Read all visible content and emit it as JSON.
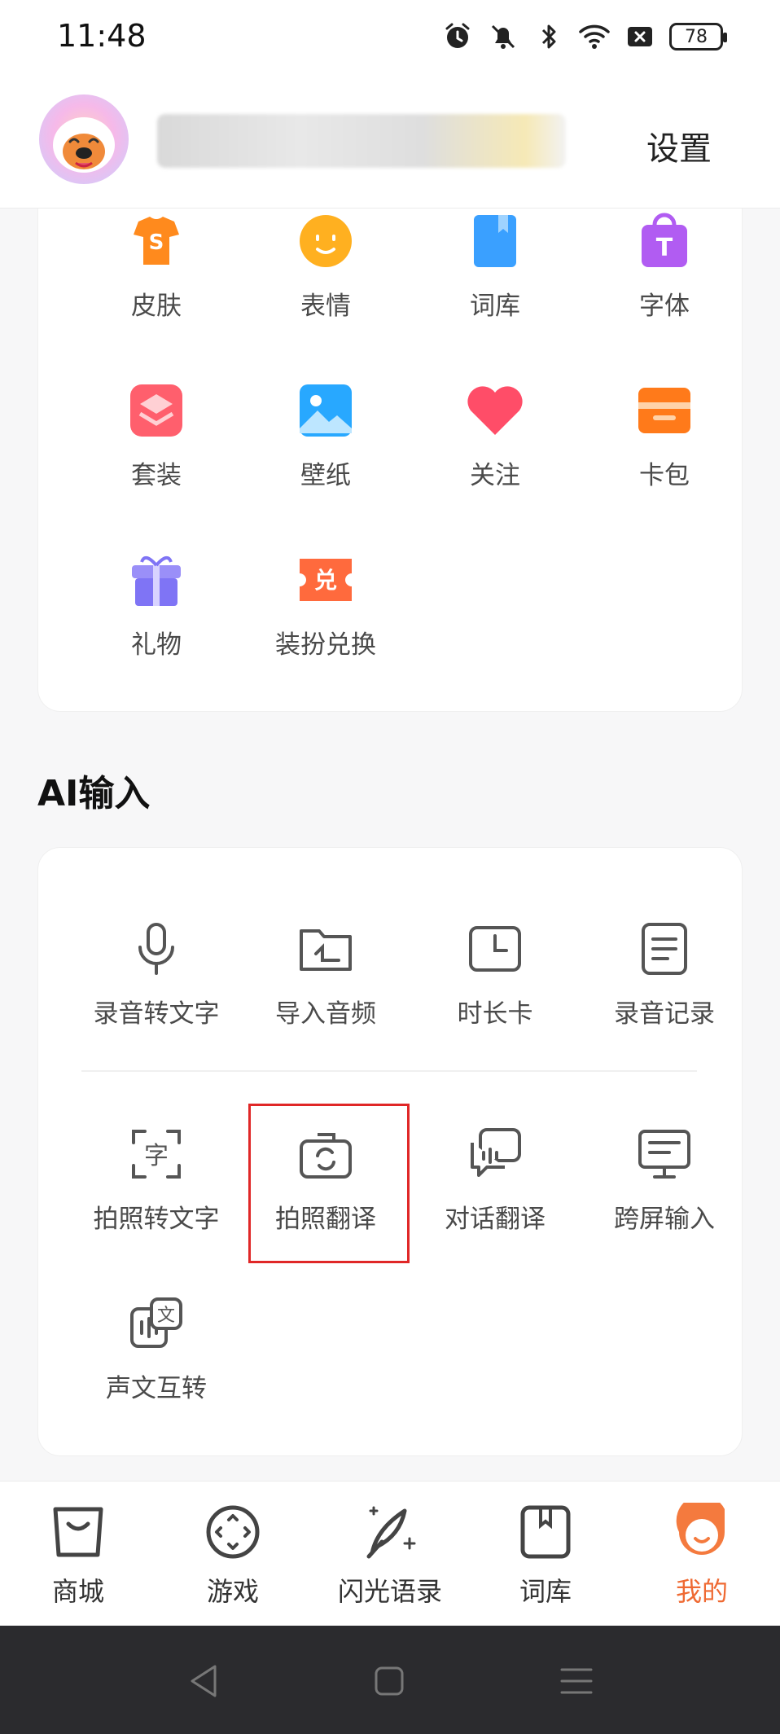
{
  "status_bar": {
    "time": "11:48",
    "battery": "78"
  },
  "header": {
    "settings_label": "设置"
  },
  "decor_items": [
    {
      "label": "皮肤",
      "icon": "shirt-icon",
      "color": "#ff8a1d"
    },
    {
      "label": "表情",
      "icon": "emoji-icon",
      "color": "#ffb020"
    },
    {
      "label": "词库",
      "icon": "book-icon",
      "color": "#3aa0ff"
    },
    {
      "label": "字体",
      "icon": "font-bag-icon",
      "color": "#b15cf2"
    },
    {
      "label": "套装",
      "icon": "suit-icon",
      "color": "#ff5f6d"
    },
    {
      "label": "壁纸",
      "icon": "wallpaper-icon",
      "color": "#28a8ff"
    },
    {
      "label": "关注",
      "icon": "heart-icon",
      "color": "#ff4d68"
    },
    {
      "label": "卡包",
      "icon": "card-wallet-icon",
      "color": "#ff7a1a"
    },
    {
      "label": "礼物",
      "icon": "gift-icon",
      "color": "#7f74f5"
    },
    {
      "label": "装扮兑换",
      "icon": "redeem-ticket-icon",
      "color": "#ff6a3d",
      "badge": "兑"
    }
  ],
  "ai_section": {
    "title": "AI输入",
    "items": [
      {
        "label": "录音转文字",
        "icon": "microphone-icon"
      },
      {
        "label": "导入音频",
        "icon": "folder-icon"
      },
      {
        "label": "时长卡",
        "icon": "clock-card-icon"
      },
      {
        "label": "录音记录",
        "icon": "document-icon"
      },
      {
        "label": "拍照转文字",
        "icon": "scan-text-icon",
        "glyph": "字"
      },
      {
        "label": "拍照翻译",
        "icon": "camera-translate-icon"
      },
      {
        "label": "对话翻译",
        "icon": "chat-translate-icon"
      },
      {
        "label": "跨屏输入",
        "icon": "monitor-icon"
      },
      {
        "label": "声文互转",
        "icon": "voice-text-convert-icon",
        "glyph": "文"
      }
    ]
  },
  "tabs": [
    {
      "label": "商城",
      "icon": "shop-bag-icon",
      "active": false
    },
    {
      "label": "游戏",
      "icon": "game-icon",
      "active": false
    },
    {
      "label": "闪光语录",
      "icon": "feather-icon",
      "active": false
    },
    {
      "label": "词库",
      "icon": "bookmark-book-icon",
      "active": false
    },
    {
      "label": "我的",
      "icon": "profile-face-icon",
      "active": true
    }
  ],
  "colors": {
    "accent": "#ef6a33",
    "highlight": "#e02727"
  }
}
